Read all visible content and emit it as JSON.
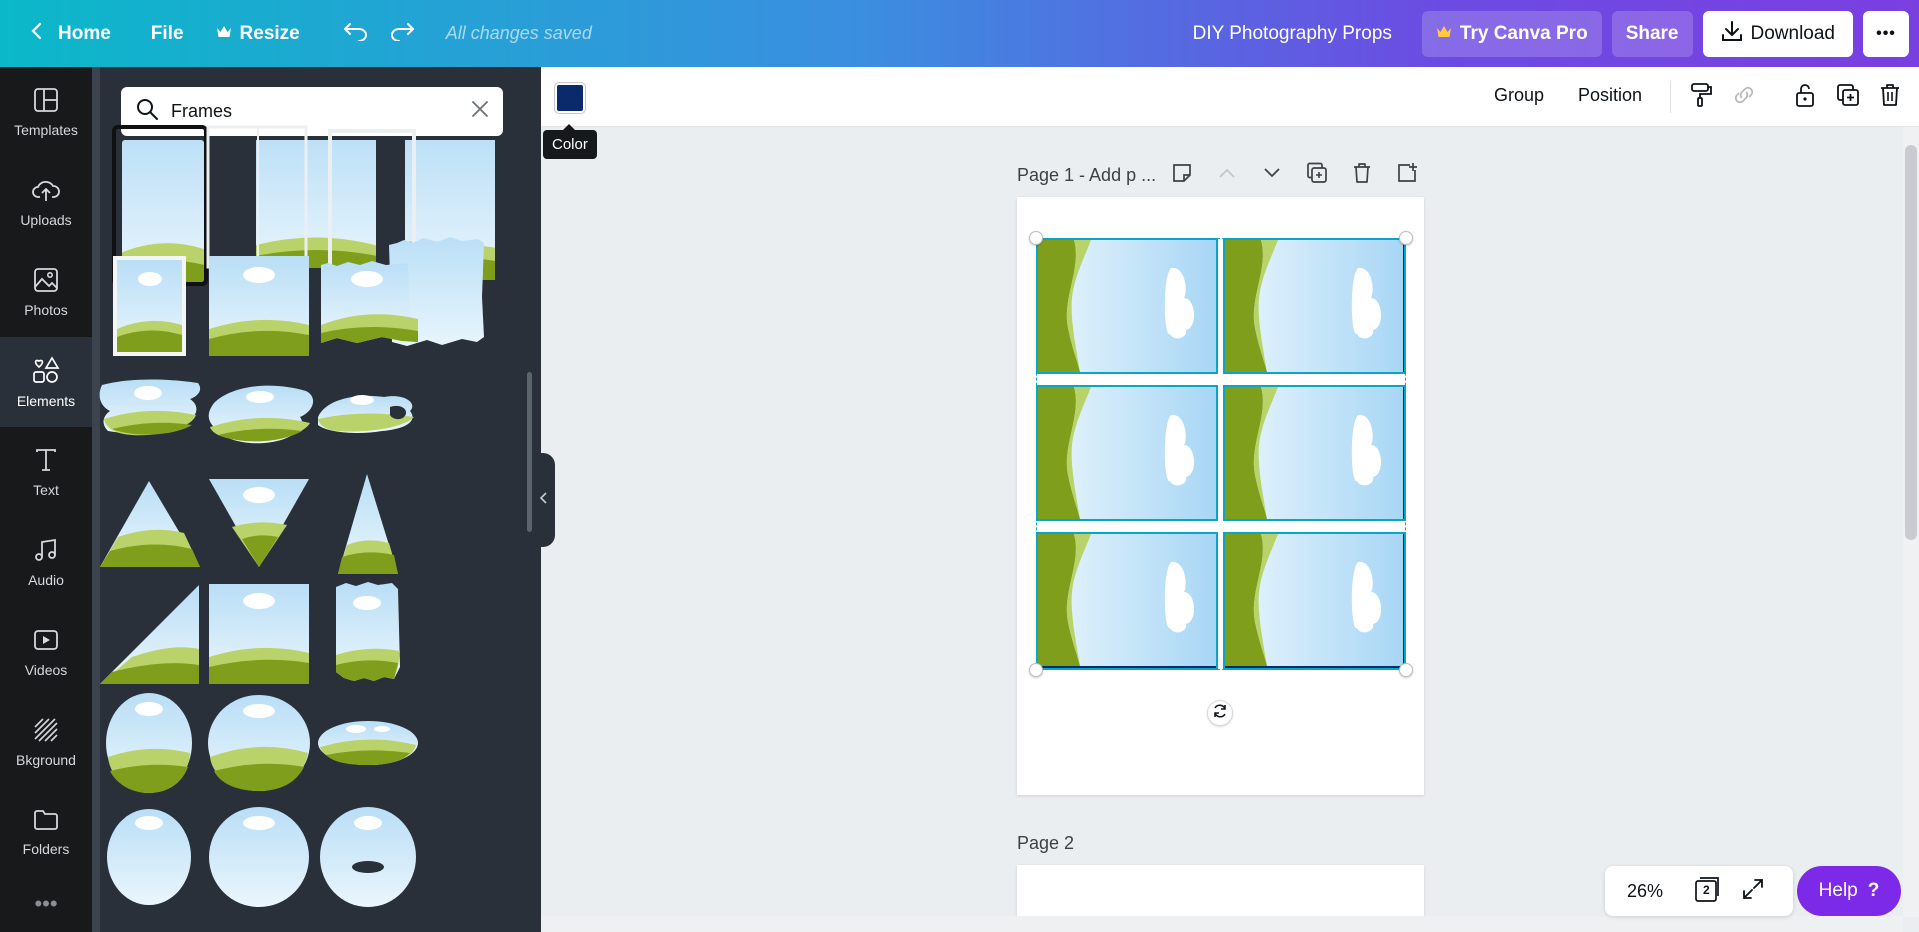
{
  "topbar": {
    "home": "Home",
    "file": "File",
    "resize": "Resize",
    "save_status": "All changes saved",
    "doc_title": "DIY Photography Props",
    "try_pro": "Try Canva Pro",
    "share": "Share",
    "download": "Download",
    "more": "•••"
  },
  "rail": {
    "items": [
      {
        "label": "Templates",
        "icon": "templates-icon"
      },
      {
        "label": "Uploads",
        "icon": "upload-cloud-icon"
      },
      {
        "label": "Photos",
        "icon": "photo-icon"
      },
      {
        "label": "Elements",
        "icon": "shapes-icon"
      },
      {
        "label": "Text",
        "icon": "text-t-icon"
      },
      {
        "label": "Audio",
        "icon": "music-note-icon"
      },
      {
        "label": "Videos",
        "icon": "video-play-icon"
      },
      {
        "label": "Bkground",
        "icon": "background-hatch-icon"
      },
      {
        "label": "Folders",
        "icon": "folder-icon"
      }
    ],
    "active": "Elements",
    "more": "•••"
  },
  "panel": {
    "search_value": "Frames"
  },
  "toolbar": {
    "color_tooltip": "Color",
    "color_value": "#0b2a6b",
    "group": "Group",
    "position": "Position"
  },
  "pages": {
    "page1_label": "Page 1 - Add p ...",
    "page2_label": "Page 2"
  },
  "zoom": {
    "value": "26%",
    "page_count": "2"
  },
  "help": {
    "label": "Help",
    "icon": "?"
  },
  "colors": {
    "sky": "#d9effb",
    "grass_dark": "#7f9e1c",
    "grass_light": "#b9d36a",
    "selection": "#0aa6c8",
    "brand_purple": "#7d2ae8"
  }
}
